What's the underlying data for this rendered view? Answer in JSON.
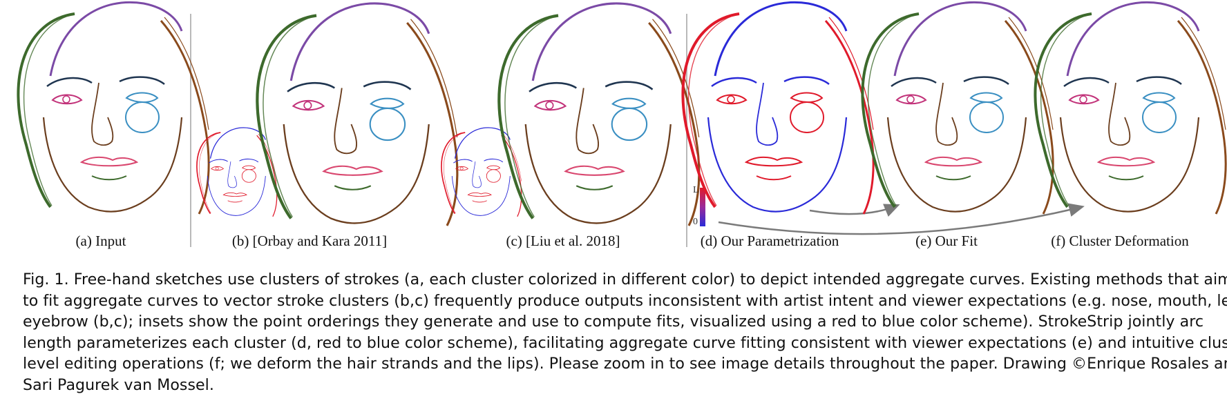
{
  "figure": {
    "panels": [
      {
        "id": "a",
        "label": "(a) Input"
      },
      {
        "id": "b",
        "label": "(b) [Orbay and Kara 2011]"
      },
      {
        "id": "c",
        "label": "(c) [Liu et al. 2018]"
      },
      {
        "id": "d",
        "label": "(d) Our Parametrization"
      },
      {
        "id": "e",
        "label": "(e) Our Fit"
      },
      {
        "id": "f",
        "label": "(f) Cluster Deformation"
      }
    ],
    "scale": {
      "top": "L",
      "bottom": "0"
    },
    "colors": {
      "hair_green": "#3d6a2c",
      "hair_purple": "#7b4aa6",
      "hair_brown": "#8a4a1c",
      "eyebrow_navy": "#1f3550",
      "eye_pink": "#c2337a",
      "eye_blue": "#3a8fc2",
      "mouth_pink": "#d9476f",
      "face_brown": "#6b3e1e",
      "param_red": "#e01a2b",
      "param_blue": "#2a2ad8",
      "divider": "#b9b9b9",
      "arrow": "#7a7a7a"
    }
  },
  "caption": {
    "lines": [
      "Fig. 1.  Free-hand sketches use clusters of strokes (a, each cluster colorized in different color) to depict intended aggregate curves. Existing methods that aim",
      "to fit aggregate curves to vector stroke clusters (b,c) frequently produce outputs inconsistent with artist intent and viewer expectations (e.g. nose, mouth, left",
      "eyebrow (b,c); insets show the point orderings they generate and use to compute fits, visualized using a red to blue color scheme). StrokeStrip jointly arc",
      "length parameterizes each cluster (d, red to blue color scheme), facilitating aggregate curve fitting consistent with viewer expectations (e) and intuitive cluster",
      "level editing operations (f; we deform the hair strands and the lips). Please zoom in to see image details throughout the paper. Drawing ©Enrique Rosales and",
      "Sari Pagurek van Mossel."
    ]
  }
}
